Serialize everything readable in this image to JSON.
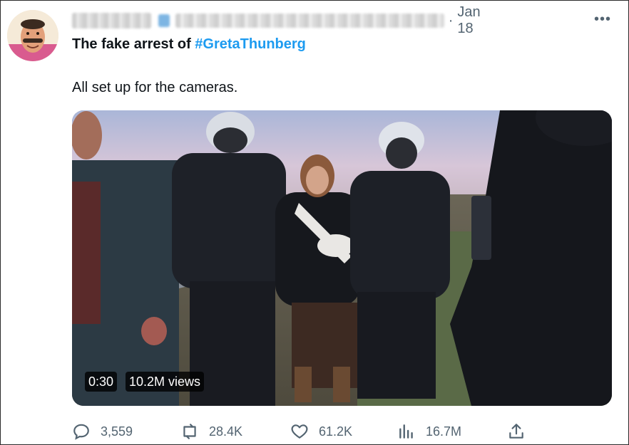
{
  "tweet": {
    "date_separator": "·",
    "date": "Jan 18",
    "more_label": "•••",
    "title_prefix": "The fake arrest of ",
    "hashtag": "#GretaThunberg",
    "body": "All set up for the cameras.",
    "author_name_obscured": true
  },
  "media": {
    "duration": "0:30",
    "views": "10.2M views"
  },
  "actions": {
    "replies": "3,559",
    "retweets": "28.4K",
    "likes": "61.2K",
    "views": "16.7M"
  },
  "colors": {
    "link": "#1d9bf0",
    "secondary_text": "#536471",
    "primary_text": "#0f1419"
  }
}
